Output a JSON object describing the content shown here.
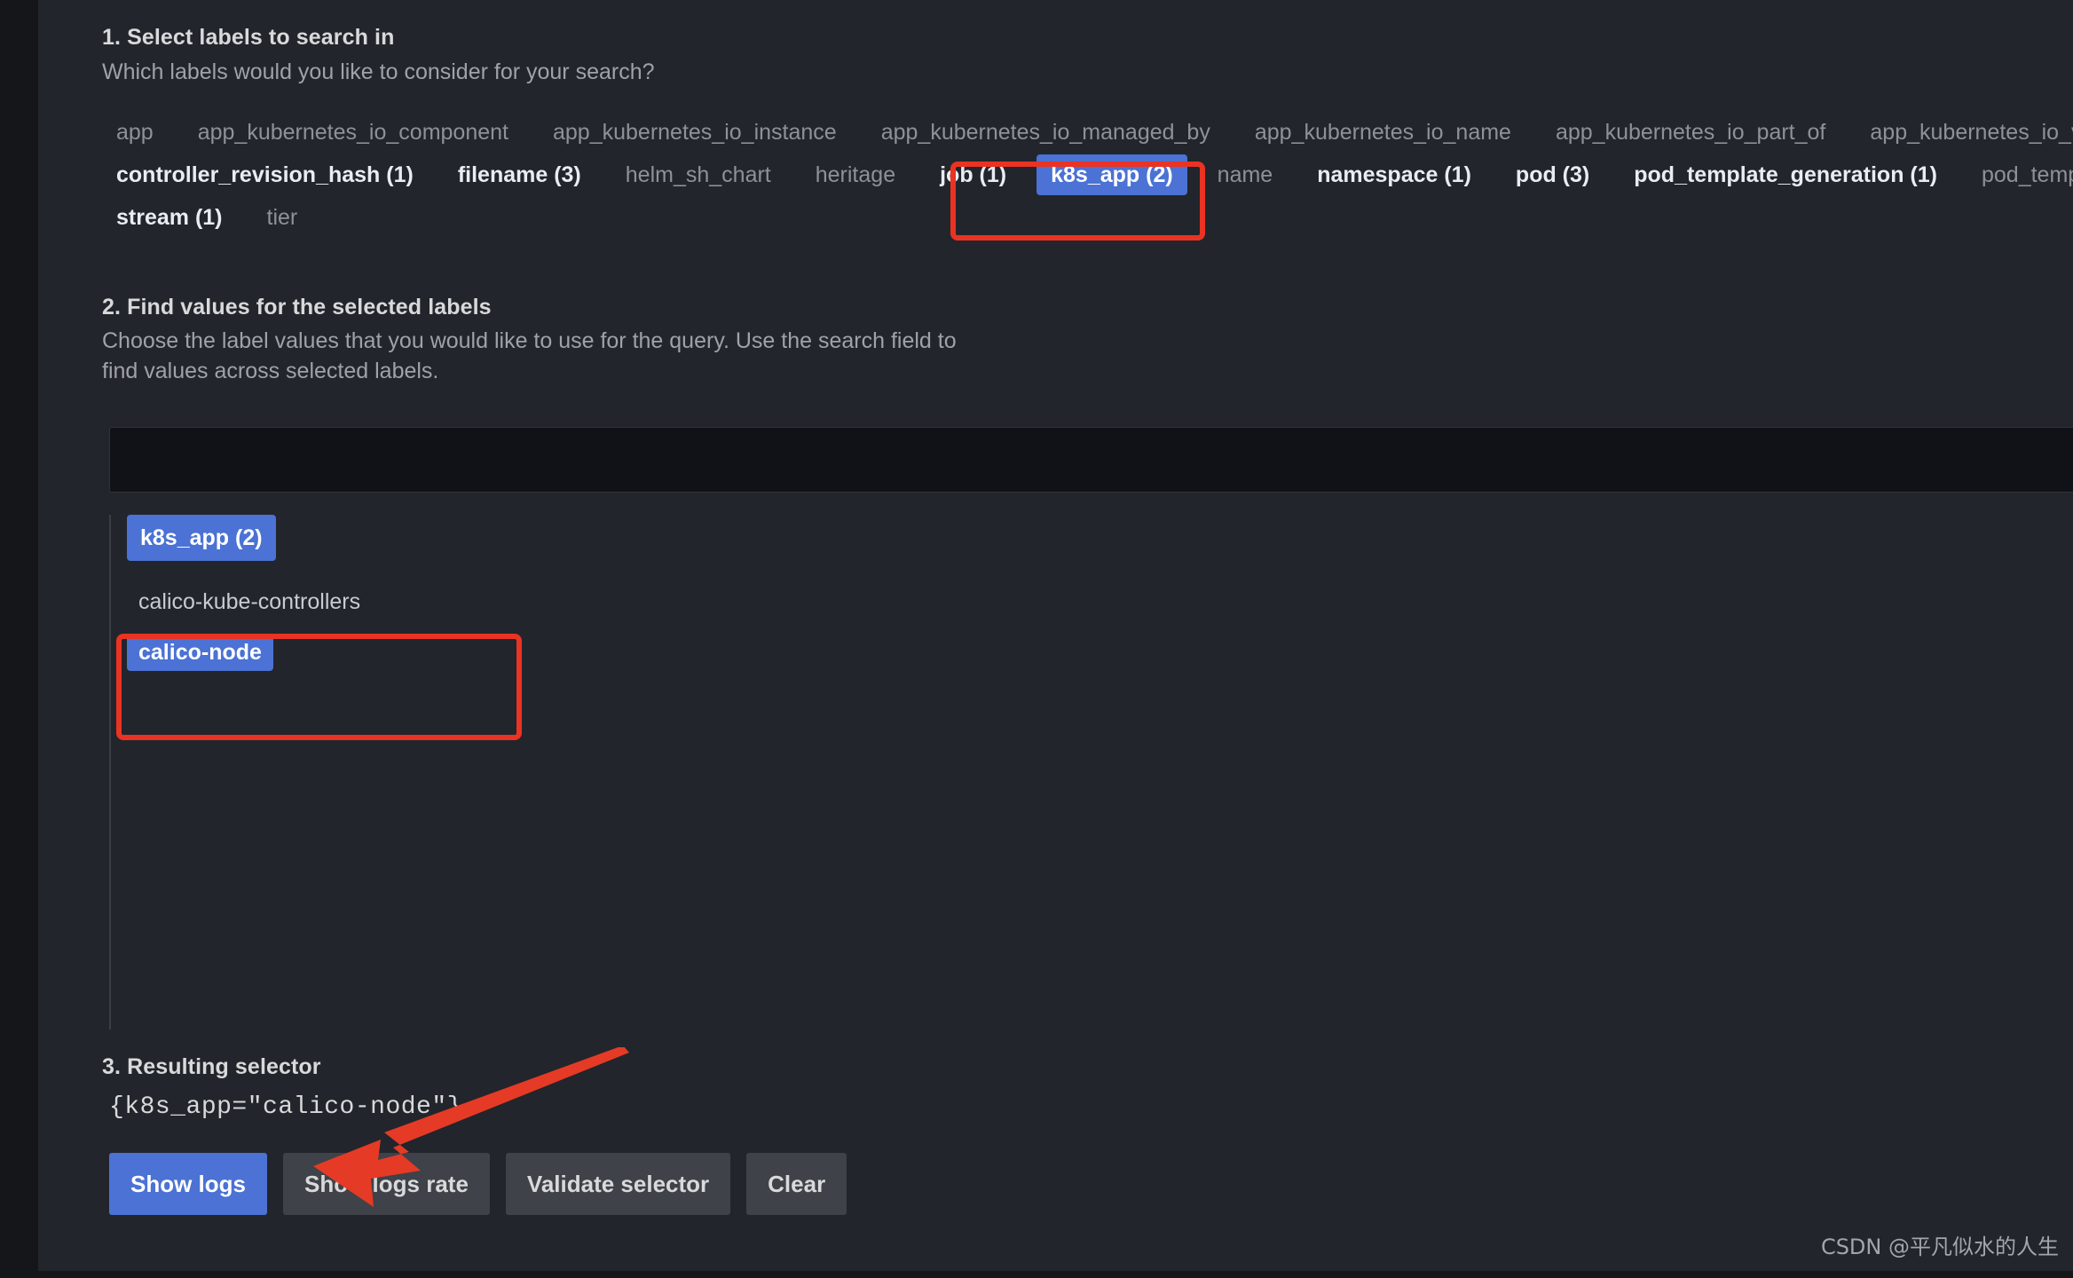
{
  "sections": {
    "step1": {
      "title": "1. Select labels to search in",
      "subtitle": "Which labels would you like to consider for your search?"
    },
    "step2": {
      "title": "2. Find values for the selected labels",
      "subtitle_line1": "Choose the label values that you would like to use for the query. Use the search field to",
      "subtitle_line2": "find values across selected labels."
    },
    "step3": {
      "title": "3. Resulting selector",
      "selector": "{k8s_app=\"calico-node\"}"
    }
  },
  "label_chips": {
    "row1": [
      {
        "label": "app",
        "selected": false,
        "has_count": false
      },
      {
        "label": "app_kubernetes_io_component",
        "selected": false,
        "has_count": false
      },
      {
        "label": "app_kubernetes_io_instance",
        "selected": false,
        "has_count": false
      },
      {
        "label": "app_kubernetes_io_managed_by",
        "selected": false,
        "has_count": false
      },
      {
        "label": "app_kubernetes_io_name",
        "selected": false,
        "has_count": false
      },
      {
        "label": "app_kubernetes_io_part_of",
        "selected": false,
        "has_count": false
      },
      {
        "label": "app_kubernetes_io_version",
        "selected": false,
        "has_count": false
      }
    ],
    "row2": [
      {
        "label": "controller_revision_hash (1)",
        "selected": false,
        "has_count": true
      },
      {
        "label": "filename (3)",
        "selected": false,
        "has_count": true
      },
      {
        "label": "helm_sh_chart",
        "selected": false,
        "has_count": false
      },
      {
        "label": "heritage",
        "selected": false,
        "has_count": false
      },
      {
        "label": "job (1)",
        "selected": false,
        "has_count": true
      },
      {
        "label": "k8s_app (2)",
        "selected": true,
        "has_count": true
      },
      {
        "label": "name",
        "selected": false,
        "has_count": false
      },
      {
        "label": "namespace (1)",
        "selected": false,
        "has_count": true
      },
      {
        "label": "pod (3)",
        "selected": false,
        "has_count": true
      },
      {
        "label": "pod_template_generation (1)",
        "selected": false,
        "has_count": true
      },
      {
        "label": "pod_template_hash",
        "selected": false,
        "has_count": false
      }
    ],
    "row3": [
      {
        "label": "stream (1)",
        "selected": false,
        "has_count": true
      },
      {
        "label": "tier",
        "selected": false,
        "has_count": false
      }
    ]
  },
  "value_search": {
    "value": "",
    "placeholder": ""
  },
  "value_columns": [
    {
      "header": "k8s_app (2)",
      "values": [
        {
          "label": "calico-kube-controllers",
          "selected": false
        },
        {
          "label": "calico-node",
          "selected": true
        }
      ]
    }
  ],
  "buttons": [
    {
      "label": "Show logs",
      "primary": true
    },
    {
      "label": "Show logs rate",
      "primary": false
    },
    {
      "label": "Validate selector",
      "primary": false
    },
    {
      "label": "Clear",
      "primary": false
    }
  ],
  "annotations": {
    "highlight_color": "#ea3323",
    "arrow_color": "#e53a26",
    "boxed_elements": [
      "k8s_app (2)",
      "calico-node"
    ],
    "arrow_points_to": "Show logs"
  },
  "watermark": "CSDN @平凡似水的人生",
  "colors": {
    "panel_bg": "#22252b",
    "page_bg": "#141619",
    "accent_blue": "#4b72d4",
    "text_primary": "#d8d9da",
    "text_muted": "#8e9297",
    "button_bg": "#3f4248",
    "input_bg": "#111217"
  }
}
